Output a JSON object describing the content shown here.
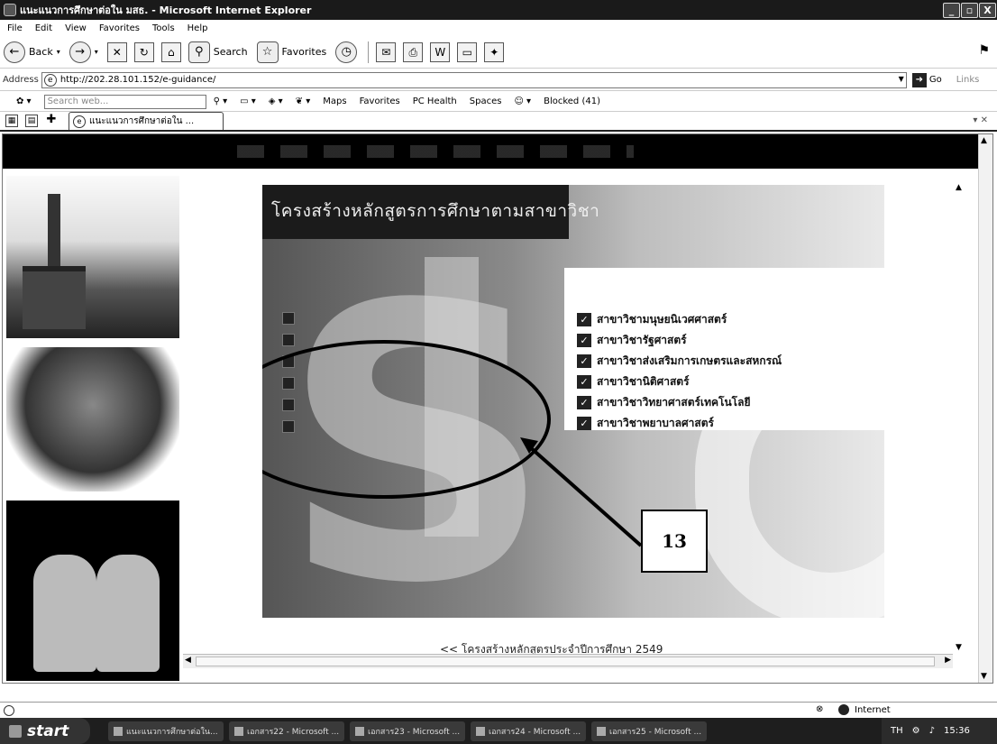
{
  "window": {
    "title": "แนะแนวการศึกษาต่อใน มสธ. - Microsoft Internet Explorer",
    "min": "_",
    "max": "▫",
    "close": "X"
  },
  "menu": [
    "File",
    "Edit",
    "View",
    "Favorites",
    "Tools",
    "Help"
  ],
  "toolbar": {
    "back": "Back",
    "search": "Search",
    "favorites": "Favorites"
  },
  "address": {
    "label": "Address",
    "url": "http://202.28.101.152/e-guidance/",
    "go": "Go",
    "links": "Links"
  },
  "searchbar": {
    "placeholder": "Search web...",
    "items": [
      "Maps",
      "Favorites",
      "PC Health",
      "Spaces",
      "Blocked (41)"
    ]
  },
  "tab": {
    "label": "แนะแนวการศึกษาต่อใน ..."
  },
  "banner": {
    "title": "โครงสร้างหลักสูตรการศึกษาตามสาขาวิชา",
    "items": [
      "สาขาวิชามนุษยนิเวศศาสตร์",
      "สาขาวิชารัฐศาสตร์",
      "สาขาวิชาส่งเสริมการเกษตรและสหกรณ์",
      "สาขาวิชานิติศาสตร์",
      "สาขาวิชาวิทยาศาสตร์เทคโนโลยี",
      "สาขาวิชาพยาบาลศาสตร์"
    ],
    "callout": "13"
  },
  "footer_link": "<< โครงสร้างหลักสูตรประจำปีการศึกษา 2549",
  "status": {
    "zone": "Internet"
  },
  "taskbar": {
    "start": "start",
    "tasks": [
      "แนะแนวการศึกษาต่อใน...",
      "เอกสาร22 - Microsoft ...",
      "เอกสาร23 - Microsoft ...",
      "เอกสาร24 - Microsoft ...",
      "เอกสาร25 - Microsoft ..."
    ],
    "lang": "TH",
    "clock": "15:36"
  }
}
